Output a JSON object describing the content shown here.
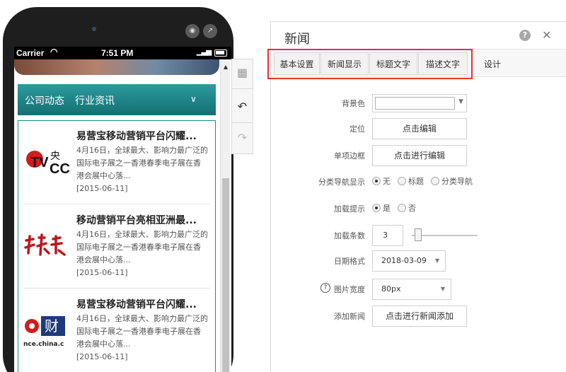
{
  "phone": {
    "status": {
      "carrier": "Carrier",
      "time": "7:51 PM"
    },
    "category_bar": {
      "item1": "公司动态",
      "item2": "行业资讯"
    },
    "news": [
      {
        "title": "易营宝移动营销平台闪耀...",
        "desc": "4月16日，全球最大、影响力最广泛的国际电子展之一香港春季电子展在香港会展中心落...",
        "date": "[2015-06-11]",
        "thumb": "cctv-logo"
      },
      {
        "title": "移动营销平台亮相亚洲最...",
        "desc": "4月16日，全球最大、影响力最广泛的国际电子展之一香港春季电子展在香港会展中心落...",
        "date": "[2015-06-11]",
        "thumb": "news-logo"
      },
      {
        "title": "易营宝移动营销平台闪耀...",
        "desc": "4月16日，全球最大、影响力最广泛的国际电子展之一香港春季电子展在香港会展中心落...",
        "date": "[2015-06-11]",
        "thumb": "caijing-logo",
        "thumb_text": "财",
        "thumb_url": "nce.china.c"
      }
    ]
  },
  "panel": {
    "title": "新闻",
    "tabs": [
      "基本设置",
      "新闻显示",
      "标题文字",
      "描述文字",
      "设计"
    ],
    "fields": {
      "bg_color": {
        "label": "背景色"
      },
      "position": {
        "label": "定位",
        "button": "点击编辑"
      },
      "border": {
        "label": "单项边框",
        "button": "点击进行编辑"
      },
      "nav": {
        "label": "分类导航显示",
        "options": [
          "无",
          "标题",
          "分类导航"
        ],
        "selected": "无"
      },
      "loading": {
        "label": "加载提示",
        "options": [
          "是",
          "否"
        ],
        "selected": "是"
      },
      "count": {
        "label": "加载条数",
        "value": "3"
      },
      "date_format": {
        "label": "日期格式",
        "value": "2018-03-09"
      },
      "img_width": {
        "label": "图片宽度",
        "value": "80px"
      },
      "add_news": {
        "label": "添加新闻",
        "button": "点击进行新闻添加"
      }
    }
  },
  "colors": {
    "accent_teal": "#1a8a8c",
    "highlight_red": "#e8302e"
  }
}
